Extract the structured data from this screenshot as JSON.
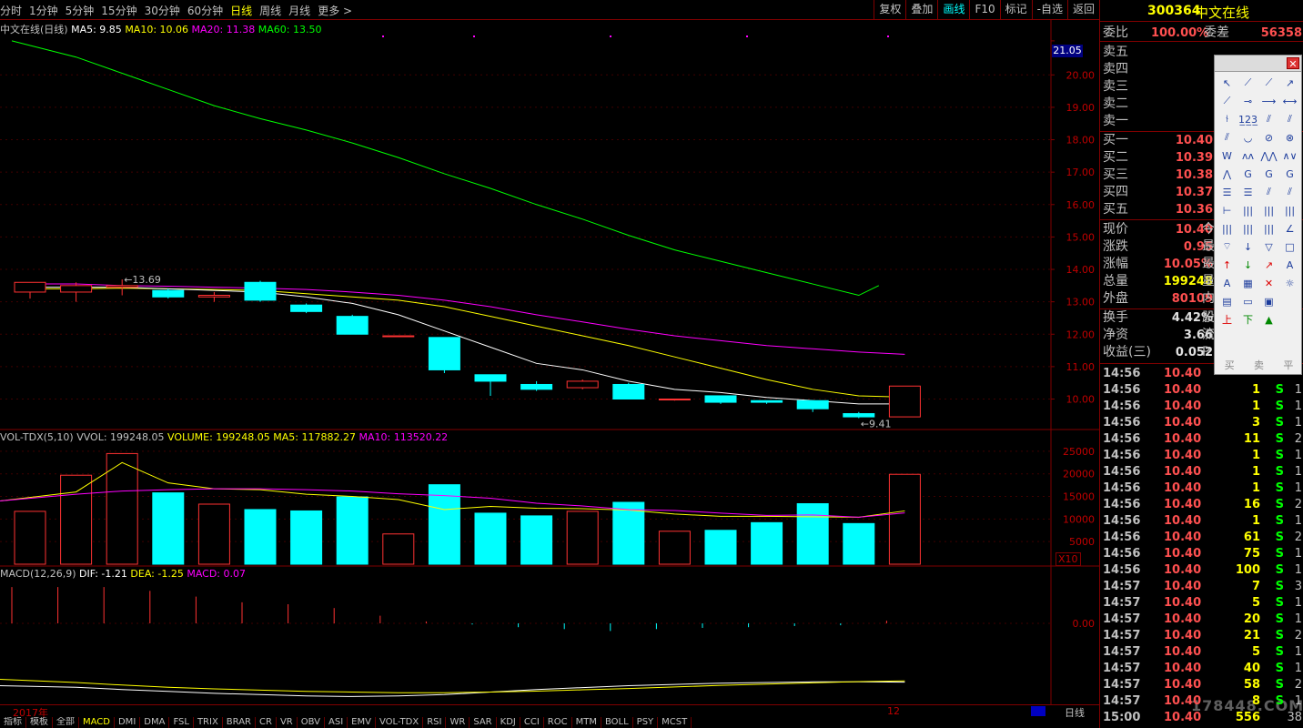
{
  "toolbar": {
    "periods": [
      "分时",
      "1分钟",
      "5分钟",
      "15分钟",
      "30分钟",
      "60分钟",
      "日线",
      "周线",
      "月线",
      "更多 >"
    ],
    "active_period": "日线",
    "right_tools": [
      "复权",
      "叠加",
      "画线",
      "F10",
      "标记",
      "-自选",
      "返回"
    ],
    "active_tool": "画线"
  },
  "main_legend": {
    "name": "中文在线(日线)",
    "ma5": "MA5: 9.85",
    "ma10": "MA10: 10.06",
    "ma20": "MA20: 11.38",
    "ma60": "MA60: 13.50"
  },
  "price_axis": [
    "21.05",
    "20.00",
    "19.00",
    "18.00",
    "17.00",
    "16.00",
    "15.00",
    "14.00",
    "13.00",
    "12.00",
    "11.00",
    "10.00"
  ],
  "annotations": {
    "high": "13.69",
    "low": "9.41"
  },
  "vol_legend": {
    "name": "VOL-TDX(5,10)",
    "vvol": "VVOL: 199248.05",
    "volume": "VOLUME: 199248.05",
    "ma5": "MA5: 117882.27",
    "ma10": "MA10: 113520.22"
  },
  "vol_axis": [
    "25000",
    "20000",
    "15000",
    "10000",
    "5000"
  ],
  "vol_unit": "X10",
  "macd_legend": {
    "name": "MACD(12,26,9)",
    "dif": "DIF: -1.21",
    "dea": "DEA: -1.25",
    "macd": "MACD: 0.07"
  },
  "macd_axis": "0.00",
  "date_bar": {
    "year": "2017年",
    "month": "12",
    "period": "日线"
  },
  "bottom_tabs": [
    "指标",
    "模板",
    "全部",
    "MACD",
    "DMI",
    "DMA",
    "FSL",
    "TRIX",
    "BRAR",
    "CR",
    "VR",
    "OBV",
    "ASI",
    "EMV",
    "VOL-TDX",
    "RSI",
    "WR",
    "SAR",
    "KDJ",
    "CCI",
    "ROC",
    "MTM",
    "BOLL",
    "PSY",
    "MCST"
  ],
  "active_tab": "MACD",
  "chart_data": {
    "type": "candlestick",
    "candles": [
      {
        "o": 13.3,
        "c": 13.6,
        "h": 13.6,
        "l": 13.1,
        "up": true
      },
      {
        "o": 13.3,
        "c": 13.5,
        "h": 13.6,
        "l": 13.0,
        "up": true
      },
      {
        "o": 13.45,
        "c": 13.5,
        "h": 13.69,
        "l": 13.2,
        "up": true
      },
      {
        "o": 13.35,
        "c": 13.15,
        "h": 13.4,
        "l": 13.1,
        "up": false
      },
      {
        "o": 13.15,
        "c": 13.2,
        "h": 13.3,
        "l": 13.0,
        "up": true
      },
      {
        "o": 13.6,
        "c": 13.05,
        "h": 13.65,
        "l": 13.0,
        "up": false
      },
      {
        "o": 12.9,
        "c": 12.7,
        "h": 12.95,
        "l": 12.65,
        "up": false
      },
      {
        "o": 12.55,
        "c": 12.0,
        "h": 12.6,
        "l": 12.0,
        "up": false
      },
      {
        "o": 11.95,
        "c": 11.95,
        "h": 11.95,
        "l": 11.95,
        "up": true
      },
      {
        "o": 11.9,
        "c": 10.9,
        "h": 11.9,
        "l": 10.8,
        "up": false
      },
      {
        "o": 10.75,
        "c": 10.55,
        "h": 10.75,
        "l": 10.1,
        "up": false
      },
      {
        "o": 10.45,
        "c": 10.3,
        "h": 10.55,
        "l": 10.25,
        "up": false
      },
      {
        "o": 10.35,
        "c": 10.55,
        "h": 10.6,
        "l": 10.3,
        "up": true
      },
      {
        "o": 10.45,
        "c": 10.0,
        "h": 10.5,
        "l": 10.0,
        "up": false
      },
      {
        "o": 10.0,
        "c": 10.0,
        "h": 10.0,
        "l": 9.95,
        "up": true
      },
      {
        "o": 10.1,
        "c": 9.9,
        "h": 10.1,
        "l": 9.85,
        "up": false
      },
      {
        "o": 9.95,
        "c": 9.9,
        "h": 9.95,
        "l": 9.85,
        "up": false
      },
      {
        "o": 9.95,
        "c": 9.7,
        "h": 9.95,
        "l": 9.6,
        "up": false
      },
      {
        "o": 9.55,
        "c": 9.45,
        "h": 9.6,
        "l": 9.41,
        "up": false
      },
      {
        "o": 9.45,
        "c": 10.4,
        "h": 10.4,
        "l": 9.45,
        "up": true
      }
    ],
    "ma5": [
      13.45,
      13.45,
      13.45,
      13.4,
      13.35,
      13.3,
      13.15,
      12.95,
      12.6,
      12.1,
      11.6,
      11.1,
      10.9,
      10.55,
      10.3,
      10.2,
      10.05,
      9.95,
      9.85,
      9.85
    ],
    "ma10": [
      13.4,
      13.4,
      13.42,
      13.4,
      13.38,
      13.35,
      13.25,
      13.15,
      13.05,
      12.85,
      12.55,
      12.25,
      11.95,
      11.65,
      11.3,
      10.95,
      10.6,
      10.3,
      10.1,
      10.06
    ],
    "ma20": [
      13.55,
      13.55,
      13.5,
      13.48,
      13.45,
      13.42,
      13.38,
      13.3,
      13.2,
      13.05,
      12.85,
      12.6,
      12.38,
      12.15,
      11.95,
      11.8,
      11.65,
      11.55,
      11.45,
      11.38
    ],
    "ma60": [
      21.05,
      20.55,
      20.05,
      19.55,
      19.05,
      18.65,
      18.3,
      17.9,
      17.45,
      16.95,
      16.5,
      16.0,
      15.55,
      15.05,
      14.6,
      14.25,
      13.9,
      13.55,
      13.2,
      13.5
    ],
    "volume": [
      11700,
      19700,
      24500,
      15800,
      13300,
      12100,
      11800,
      14900,
      6700,
      17600,
      11300,
      10700,
      11700,
      13700,
      7300,
      7500,
      9200,
      13400,
      9000,
      19900
    ],
    "vol_ma5": [
      14000,
      16000,
      22500,
      18000,
      16700,
      16500,
      15500,
      15000,
      14300,
      12100,
      12800,
      12400,
      12300,
      12000,
      11100,
      10600,
      10600,
      10500,
      10400,
      11800
    ],
    "vol_ma10": [
      14000,
      15500,
      16200,
      16500,
      16700,
      16700,
      16500,
      16200,
      15600,
      15200,
      14600,
      13500,
      12900,
      12100,
      11900,
      11300,
      10800,
      10900,
      10400,
      11350
    ],
    "macd_bars": [
      0.95,
      0.95,
      0.95,
      0.85,
      0.7,
      0.55,
      0.5,
      0.4,
      0.2,
      0.05,
      -0.03,
      -0.1,
      -0.15,
      -0.2,
      -0.15,
      -0.12,
      -0.1,
      -0.07,
      -0.05,
      0.07
    ],
    "dif": [
      -1.1,
      -1.05,
      -0.98,
      -0.92,
      -0.86,
      -0.82,
      -0.78,
      -0.76,
      -0.78,
      -0.82,
      -0.9,
      -0.98,
      -1.04,
      -1.1,
      -1.14,
      -1.18,
      -1.2,
      -1.22,
      -1.22,
      -1.21
    ],
    "dea": [
      -1.3,
      -1.2,
      -1.12,
      -1.05,
      -1.0,
      -0.96,
      -0.92,
      -0.9,
      -0.88,
      -0.88,
      -0.9,
      -0.93,
      -0.97,
      -1.01,
      -1.06,
      -1.11,
      -1.15,
      -1.19,
      -1.23,
      -1.25
    ]
  },
  "quote": {
    "code": "300364",
    "name": "中文在线",
    "webi_label": "委比",
    "webi_value": "100.00%",
    "wecha_label": "委差",
    "wecha_value": "56358",
    "sell": [
      {
        "label": "卖五",
        "price": ""
      },
      {
        "label": "卖四",
        "price": ""
      },
      {
        "label": "卖三",
        "price": ""
      },
      {
        "label": "卖二",
        "price": ""
      },
      {
        "label": "卖一",
        "price": ""
      }
    ],
    "buy": [
      {
        "label": "买一",
        "price": "10.40"
      },
      {
        "label": "买二",
        "price": "10.39"
      },
      {
        "label": "买三",
        "price": "10.38"
      },
      {
        "label": "买四",
        "price": "10.37"
      },
      {
        "label": "买五",
        "price": "10.36"
      }
    ],
    "stats": [
      {
        "label": "现价",
        "value": "10.40",
        "tail": "今"
      },
      {
        "label": "涨跌",
        "value": "0.95",
        "tail": "最"
      },
      {
        "label": "涨幅",
        "value": "10.05%",
        "tail": "最"
      },
      {
        "label": "总量",
        "value": "199248",
        "tail": "量"
      },
      {
        "label": "外盘",
        "value": "80109",
        "tail": "内"
      },
      {
        "label": "换手",
        "value": "4.42%",
        "tail": "股"
      },
      {
        "label": "净资",
        "value": "3.66",
        "tail": "流"
      },
      {
        "label": "收益(三)",
        "value": "0.052",
        "tail": "P"
      }
    ]
  },
  "ticks": [
    {
      "t": "14:56",
      "p": "10.40",
      "q": "",
      "s": "",
      "n": ""
    },
    {
      "t": "14:56",
      "p": "10.40",
      "q": "1",
      "s": "S",
      "n": "1"
    },
    {
      "t": "14:56",
      "p": "10.40",
      "q": "1",
      "s": "S",
      "n": "1"
    },
    {
      "t": "14:56",
      "p": "10.40",
      "q": "3",
      "s": "S",
      "n": "1"
    },
    {
      "t": "14:56",
      "p": "10.40",
      "q": "11",
      "s": "S",
      "n": "2"
    },
    {
      "t": "14:56",
      "p": "10.40",
      "q": "1",
      "s": "S",
      "n": "1"
    },
    {
      "t": "14:56",
      "p": "10.40",
      "q": "1",
      "s": "S",
      "n": "1"
    },
    {
      "t": "14:56",
      "p": "10.40",
      "q": "1",
      "s": "S",
      "n": "1"
    },
    {
      "t": "14:56",
      "p": "10.40",
      "q": "16",
      "s": "S",
      "n": "2"
    },
    {
      "t": "14:56",
      "p": "10.40",
      "q": "1",
      "s": "S",
      "n": "1"
    },
    {
      "t": "14:56",
      "p": "10.40",
      "q": "61",
      "s": "S",
      "n": "2"
    },
    {
      "t": "14:56",
      "p": "10.40",
      "q": "75",
      "s": "S",
      "n": "1"
    },
    {
      "t": "14:56",
      "p": "10.40",
      "q": "100",
      "s": "S",
      "n": "1"
    },
    {
      "t": "14:57",
      "p": "10.40",
      "q": "7",
      "s": "S",
      "n": "3"
    },
    {
      "t": "14:57",
      "p": "10.40",
      "q": "5",
      "s": "S",
      "n": "1"
    },
    {
      "t": "14:57",
      "p": "10.40",
      "q": "20",
      "s": "S",
      "n": "1"
    },
    {
      "t": "14:57",
      "p": "10.40",
      "q": "21",
      "s": "S",
      "n": "2"
    },
    {
      "t": "14:57",
      "p": "10.40",
      "q": "5",
      "s": "S",
      "n": "1"
    },
    {
      "t": "14:57",
      "p": "10.40",
      "q": "40",
      "s": "S",
      "n": "1"
    },
    {
      "t": "14:57",
      "p": "10.40",
      "q": "58",
      "s": "S",
      "n": "2"
    },
    {
      "t": "14:57",
      "p": "10.40",
      "q": "8",
      "s": "S",
      "n": "1"
    },
    {
      "t": "15:00",
      "p": "10.40",
      "q": "556",
      "s": "",
      "n": "38"
    }
  ],
  "watermark": "178448.COM",
  "palette": {
    "bottom_labels": [
      "买",
      "卖",
      "平"
    ]
  },
  "colors": {
    "up": "#ff3232",
    "down": "#00ffff",
    "ma5": "#ffffff",
    "ma10": "#ffff00",
    "ma20": "#ff00ff",
    "ma60": "#00ff00",
    "grid": "#800000"
  }
}
